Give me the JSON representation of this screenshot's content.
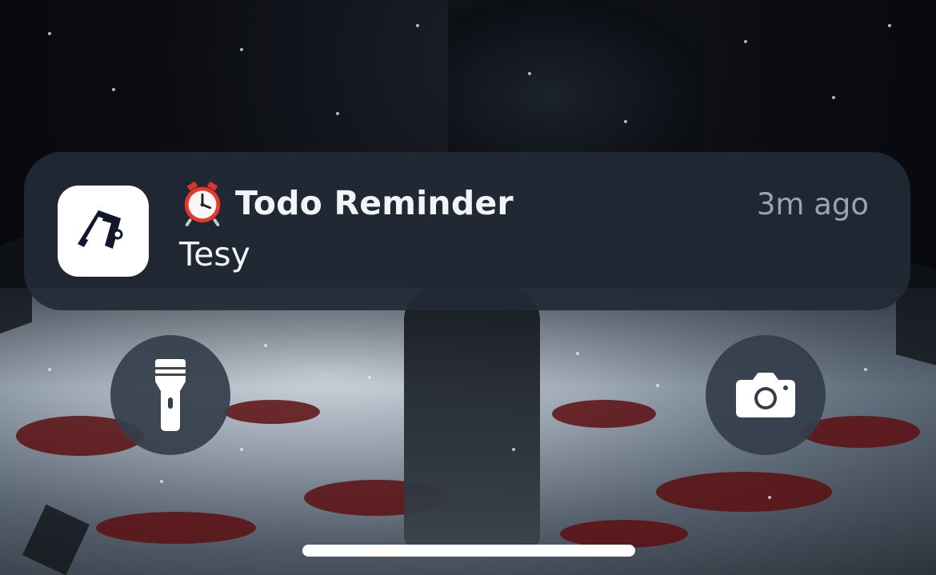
{
  "notification": {
    "app_icon": "todo-app-icon",
    "alarm_icon": "alarm-clock-icon",
    "title": "Todo Reminder",
    "time": "3m ago",
    "body": "Tesy"
  },
  "lock_screen": {
    "left_button_icon": "flashlight-icon",
    "right_button_icon": "camera-icon"
  },
  "colors": {
    "notification_bg": "#212a36",
    "title_text": "#f2f4f7",
    "time_text": "#9aa3ae",
    "button_bg": "#343e4a",
    "home_indicator": "#ffffff"
  }
}
